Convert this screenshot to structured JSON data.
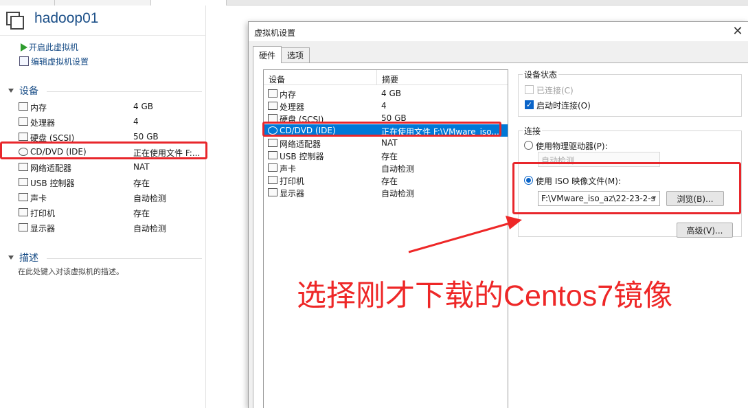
{
  "app": {
    "vm_name": "hadoop01"
  },
  "actions": {
    "power_on": "开启此虚拟机",
    "edit_settings": "编辑虚拟机设置"
  },
  "devices_section": {
    "title": "设备",
    "items": [
      {
        "name": "内存",
        "value": "4 GB",
        "icon": "memory-icon"
      },
      {
        "name": "处理器",
        "value": "4",
        "icon": "cpu-icon"
      },
      {
        "name": "硬盘 (SCSI)",
        "value": "50 GB",
        "icon": "harddisk-icon"
      },
      {
        "name": "CD/DVD (IDE)",
        "value": "正在使用文件 F:...",
        "icon": "cd-icon"
      },
      {
        "name": "网络适配器",
        "value": "NAT",
        "icon": "network-icon"
      },
      {
        "name": "USB 控制器",
        "value": "存在",
        "icon": "usb-icon"
      },
      {
        "name": "声卡",
        "value": "自动检测",
        "icon": "sound-icon"
      },
      {
        "name": "打印机",
        "value": "存在",
        "icon": "printer-icon"
      },
      {
        "name": "显示器",
        "value": "自动检测",
        "icon": "display-icon"
      }
    ]
  },
  "description_section": {
    "title": "描述",
    "placeholder": "在此处键入对该虚拟机的描述。"
  },
  "dialog": {
    "title": "虚拟机设置",
    "close": "✕",
    "tabs": [
      {
        "label": "硬件",
        "active": true
      },
      {
        "label": "选项",
        "active": false
      }
    ],
    "device_list": {
      "col_device": "设备",
      "col_summary": "摘要",
      "rows": [
        {
          "name": "内存",
          "summary": "4 GB"
        },
        {
          "name": "处理器",
          "summary": "4"
        },
        {
          "name": "硬盘 (SCSI)",
          "summary": "50 GB"
        },
        {
          "name": "CD/DVD (IDE)",
          "summary": "正在使用文件 F:\\VMware_iso...",
          "selected": true
        },
        {
          "name": "网络适配器",
          "summary": "NAT"
        },
        {
          "name": "USB 控制器",
          "summary": "存在"
        },
        {
          "name": "声卡",
          "summary": "自动检测"
        },
        {
          "name": "打印机",
          "summary": "存在"
        },
        {
          "name": "显示器",
          "summary": "自动检测"
        }
      ]
    },
    "device_status": {
      "title": "设备状态",
      "connected": "已连接(C)",
      "connect_at_power_on": "启动时连接(O)"
    },
    "connection": {
      "title": "连接",
      "physical_drive": "使用物理驱动器(P):",
      "physical_value": "自动检测",
      "iso_image": "使用 ISO 映像文件(M):",
      "iso_path": "F:\\VMware_iso_az\\22-23-2-s",
      "browse": "浏览(B)..."
    },
    "advanced": "高级(V)..."
  },
  "annotation": {
    "text": "选择刚才下载的Centos7镜像",
    "color": "#ee2727"
  },
  "colors": {
    "accent": "#0078d7",
    "link": "#1b4f88",
    "highlight": "#e8262b"
  }
}
